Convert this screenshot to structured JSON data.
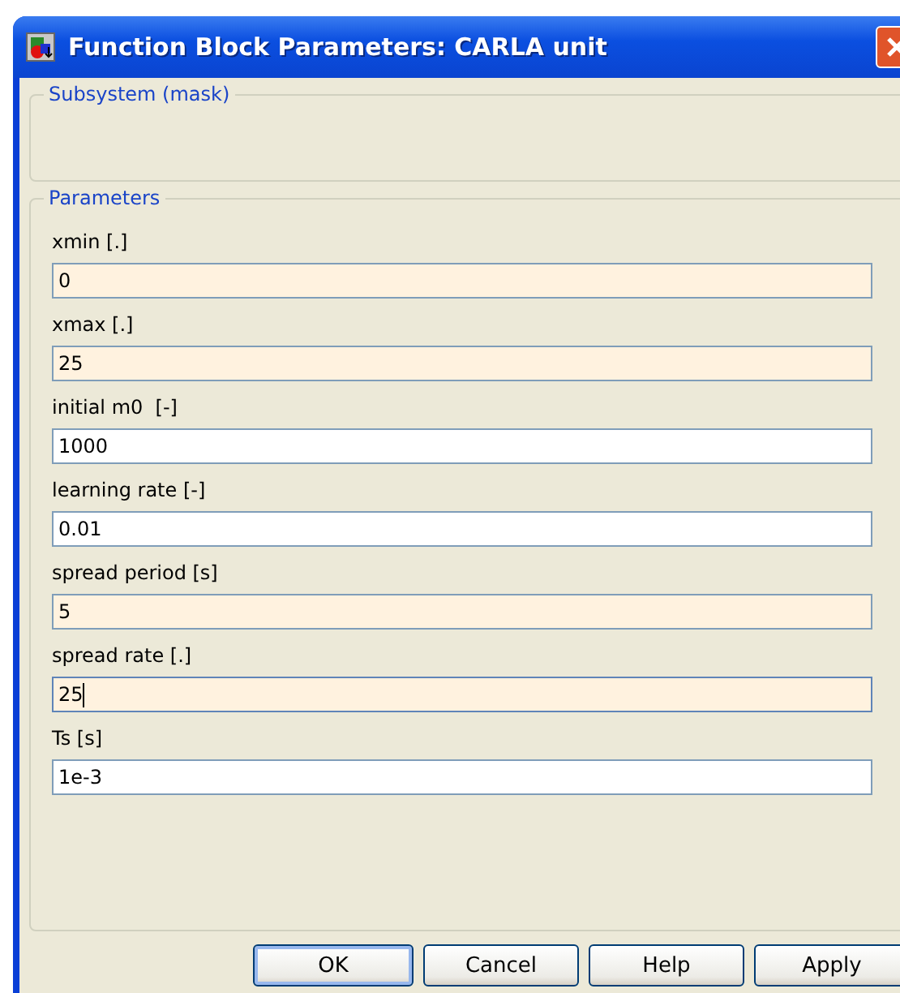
{
  "window": {
    "title": "Function Block Parameters: CARLA unit"
  },
  "subsystem": {
    "title": "Subsystem (mask)"
  },
  "parameters": {
    "title": "Parameters",
    "fields": [
      {
        "label": "xmin [.]",
        "value": "0",
        "highlighted": true,
        "focused": false
      },
      {
        "label": "xmax [.]",
        "value": "25",
        "highlighted": true,
        "focused": false
      },
      {
        "label": "initial m0  [-]",
        "value": "1000",
        "highlighted": false,
        "focused": false
      },
      {
        "label": "learning rate [-]",
        "value": "0.01",
        "highlighted": false,
        "focused": false
      },
      {
        "label": "spread period [s]",
        "value": "5",
        "highlighted": true,
        "focused": false
      },
      {
        "label": "spread rate [.]",
        "value": "25",
        "highlighted": true,
        "focused": true
      },
      {
        "label": "Ts [s]",
        "value": "1e-3",
        "highlighted": false,
        "focused": false
      }
    ]
  },
  "buttons": [
    {
      "label": "OK",
      "default": true
    },
    {
      "label": "Cancel",
      "default": false
    },
    {
      "label": "Help",
      "default": false
    },
    {
      "label": "Apply",
      "default": false
    }
  ]
}
